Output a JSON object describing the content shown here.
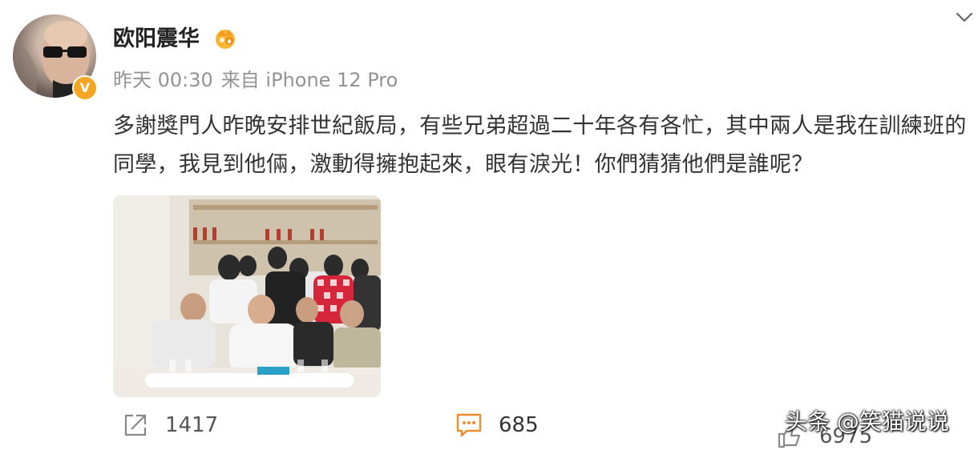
{
  "post": {
    "username": "欧阳震华",
    "verified_badge": "V",
    "time": "昨天 00:30",
    "source": "来自 iPhone 12 Pro",
    "content": "多謝獎門人昨晚安排世紀飯局，有些兄弟超過二十年各有各忙，其中兩人是我在訓練班的同學，我見到他倆，激動得擁抱起來，眼有淚光！你們猜猜他們是誰呢？",
    "reposts": "1417",
    "comments": "685",
    "likes": "6975"
  },
  "watermark": "头条 @笑猫说说",
  "icons": {
    "menu": "chevron-down-icon",
    "repost": "share-icon",
    "comment": "comment-icon",
    "like": "thumbs-up-icon",
    "vip": "crown-badge-icon"
  },
  "colors": {
    "verified": "#f5a623",
    "comment_icon": "#f08c2a",
    "meta_text": "#939393",
    "body_text": "#333333"
  }
}
